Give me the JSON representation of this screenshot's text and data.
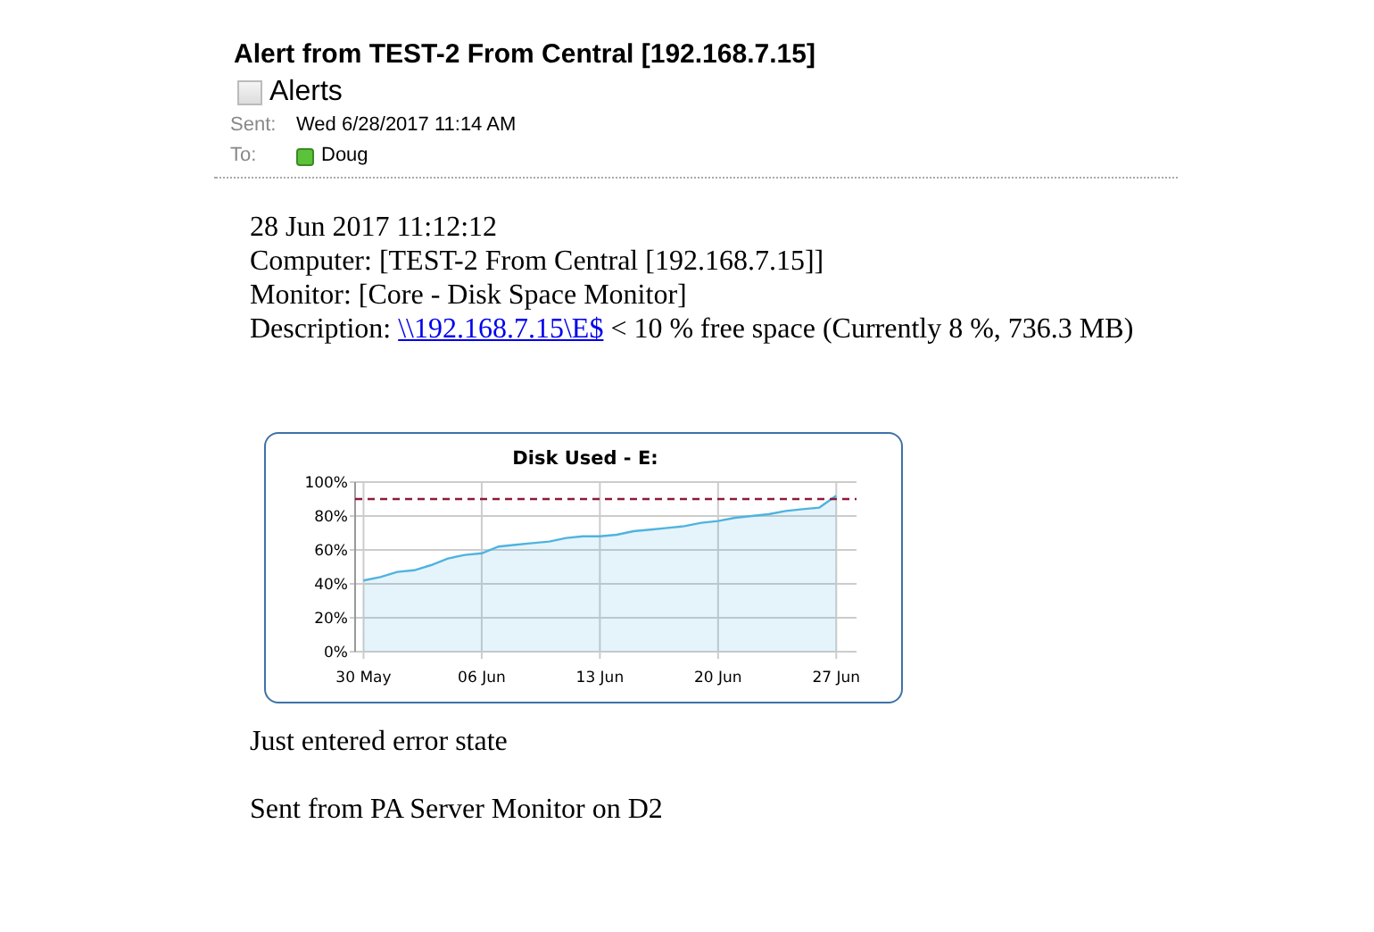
{
  "header": {
    "subject": "Alert from TEST-2 From Central [192.168.7.15]",
    "folder": {
      "label": "Alerts",
      "checked": false
    },
    "sent": {
      "label": "Sent:",
      "value": "Wed 6/28/2017 11:14 AM"
    },
    "to": {
      "label": "To:",
      "value": "Doug"
    }
  },
  "body": {
    "lines": [
      {
        "text": "28 Jun 2017 11:12:12"
      },
      {
        "text": "Computer: [TEST-2 From Central [192.168.7.15]]"
      },
      {
        "text": "Monitor: [Core - Disk Space Monitor]"
      },
      {
        "text": "Description: ",
        "link": "\\\\192.168.7.15\\E$",
        "after": " < 10 % free space (Currently 8 %, 736.3 MB)"
      }
    ],
    "chart_data": {
      "type": "area",
      "title": "Disk Used - E:",
      "categories": [
        "30 May",
        null,
        null,
        null,
        null,
        null,
        null,
        "06 Jun",
        null,
        null,
        null,
        null,
        null,
        null,
        "13 Jun",
        null,
        null,
        null,
        null,
        null,
        null,
        "20 Jun",
        null,
        null,
        null,
        null,
        null,
        null,
        "27 Jun"
      ],
      "series": [
        {
          "color": "#4fb3df",
          "values": [
            42,
            44,
            47,
            48,
            51,
            55,
            57,
            58,
            62,
            63,
            64,
            65,
            67,
            68,
            68,
            69,
            71,
            72,
            73,
            74,
            76,
            77,
            79,
            80,
            81,
            83,
            84,
            85,
            92
          ]
        }
      ],
      "ylim": [
        0,
        100
      ],
      "yticks": [
        {
          "value": 0,
          "label": "0%"
        },
        {
          "value": 20,
          "label": "20%"
        },
        {
          "value": 40,
          "label": "40%"
        },
        {
          "value": 60,
          "label": "60%"
        },
        {
          "value": 80,
          "label": "80%"
        },
        {
          "value": 100,
          "label": "100%"
        }
      ],
      "grid": true,
      "ref_lines": [
        {
          "axis": "y",
          "value": 90,
          "color": "#8b1a3a"
        }
      ]
    },
    "footer": [
      {
        "text": "Just entered error state"
      },
      {
        "text": "Sent from PA Server Monitor on D2"
      }
    ]
  }
}
